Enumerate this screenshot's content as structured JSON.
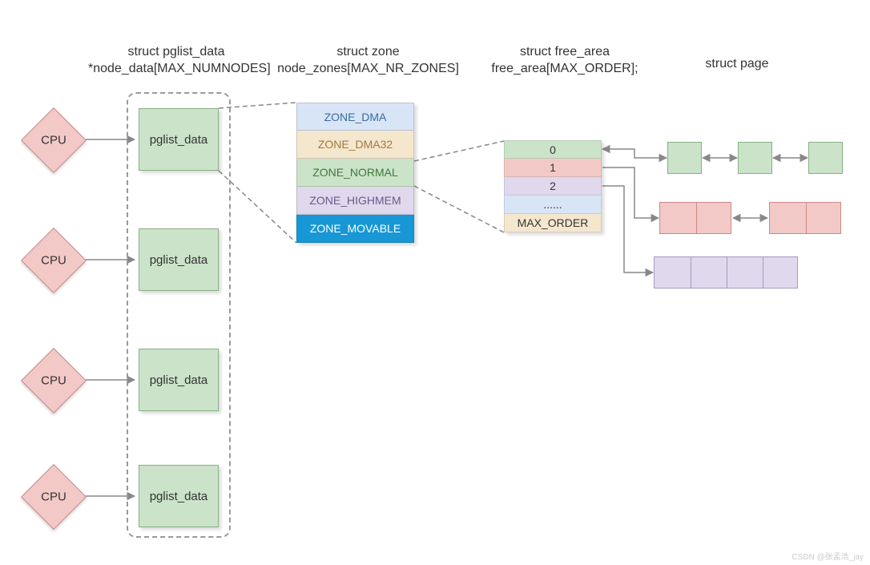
{
  "headers": {
    "pglist": "struct pglist_data\n*node_data[MAX_NUMNODES]",
    "zone": "struct zone\nnode_zones[MAX_NR_ZONES]",
    "free_area": "struct free_area\nfree_area[MAX_ORDER];",
    "page": "struct page"
  },
  "cpu_label": "CPU",
  "pglist_label": "pglist_data",
  "zones": [
    "ZONE_DMA",
    "ZONE_DMA32",
    "ZONE_NORMAL",
    "ZONE_HIGHMEM",
    "ZONE_MOVABLE"
  ],
  "free_area": [
    "0",
    "1",
    "2",
    "......",
    "MAX_ORDER"
  ],
  "watermark": "CSDN @张孟浩_jay",
  "colors": {
    "cpu_fill": "#f2c9c7",
    "pglist_fill": "#cbe3c9",
    "zone_dma": "#d8e5f6",
    "zone_dma32": "#f5e6ce",
    "zone_normal": "#cbe3c9",
    "zone_highmem": "#e0d8ec",
    "zone_movable": "#1797d6",
    "arrow": "#888888"
  }
}
